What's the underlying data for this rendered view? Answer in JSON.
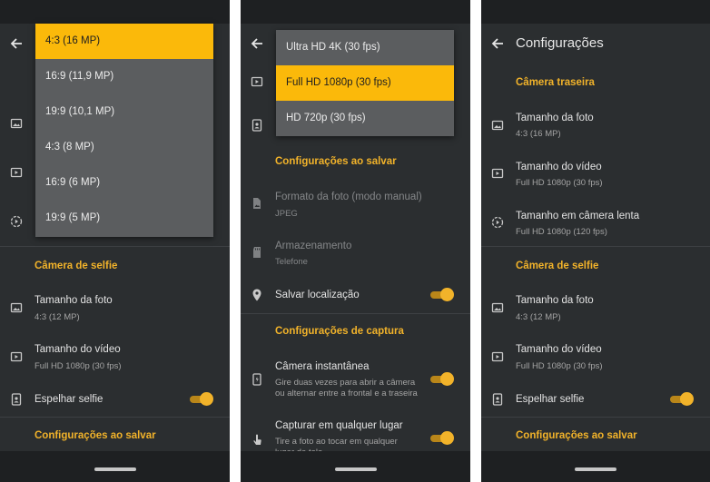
{
  "left_screen": {
    "dropdown_options": [
      {
        "label": "4:3 (16 MP)",
        "selected": true
      },
      {
        "label": "16:9 (11,9 MP)",
        "selected": false
      },
      {
        "label": "19:9 (10,1 MP)",
        "selected": false
      },
      {
        "label": "4:3 (8 MP)",
        "selected": false
      },
      {
        "label": "16:9 (6 MP)",
        "selected": false
      },
      {
        "label": "19:9 (5 MP)",
        "selected": false
      }
    ],
    "selfie_section": "Câmera de selfie",
    "photo_size_title": "Tamanho da foto",
    "photo_size_value": "4:3 (12 MP)",
    "video_size_title": "Tamanho do vídeo",
    "video_size_value": "Full HD 1080p (30 fps)",
    "mirror_selfie_title": "Espelhar selfie",
    "mirror_selfie_on": true,
    "save_section": "Configurações ao salvar"
  },
  "middle_screen": {
    "dropdown_options": [
      {
        "label": "Ultra HD 4K (30 fps)",
        "selected": false
      },
      {
        "label": "Full HD 1080p (30 fps)",
        "selected": true
      },
      {
        "label": "HD 720p (30 fps)",
        "selected": false
      }
    ],
    "save_section": "Configurações ao salvar",
    "photo_format_title": "Formato da foto (modo manual)",
    "photo_format_value": "JPEG",
    "storage_title": "Armazenamento",
    "storage_value": "Telefone",
    "save_location_title": "Salvar localização",
    "save_location_on": true,
    "capture_section": "Configurações de captura",
    "instant_camera_title": "Câmera instantânea",
    "instant_camera_desc_1": "Gire duas vezes para abrir a câmera",
    "instant_camera_desc_2": "ou alternar entre a frontal e a traseira",
    "instant_camera_on": true,
    "capture_anywhere_title": "Capturar em qualquer lugar",
    "capture_anywhere_desc_1": "Tire a foto ao tocar em qualquer",
    "capture_anywhere_desc_2": "lugar da tela",
    "capture_anywhere_on": true
  },
  "right_screen": {
    "title": "Configurações",
    "rear_section": "Câmera traseira",
    "rear_photo_title": "Tamanho da foto",
    "rear_photo_value": "4:3 (16 MP)",
    "rear_video_title": "Tamanho do vídeo",
    "rear_video_value": "Full HD 1080p (30 fps)",
    "slowmo_title": "Tamanho em câmera lenta",
    "slowmo_value": "Full HD 1080p (120 fps)",
    "selfie_section": "Câmera de selfie",
    "selfie_photo_title": "Tamanho da foto",
    "selfie_photo_value": "4:3 (12 MP)",
    "selfie_video_title": "Tamanho do vídeo",
    "selfie_video_value": "Full HD 1080p (30 fps)",
    "mirror_selfie_title": "Espelhar selfie",
    "mirror_selfie_on": true,
    "save_section": "Configurações ao salvar"
  },
  "icons": {
    "back": "arrow-left-icon",
    "photo_size": "photo-size-icon",
    "video_size": "video-size-icon",
    "slowmo": "slow-motion-icon",
    "mirror": "mirror-selfie-icon",
    "file": "file-icon",
    "storage": "sd-card-icon",
    "location": "location-pin-icon",
    "instant_camera": "quick-launch-icon",
    "touch": "touch-icon"
  },
  "colors": {
    "accent": "#f2b32a",
    "selected_option": "#fbb90a",
    "background": "#2b2e30",
    "dropdown": "#5b5d5f"
  }
}
